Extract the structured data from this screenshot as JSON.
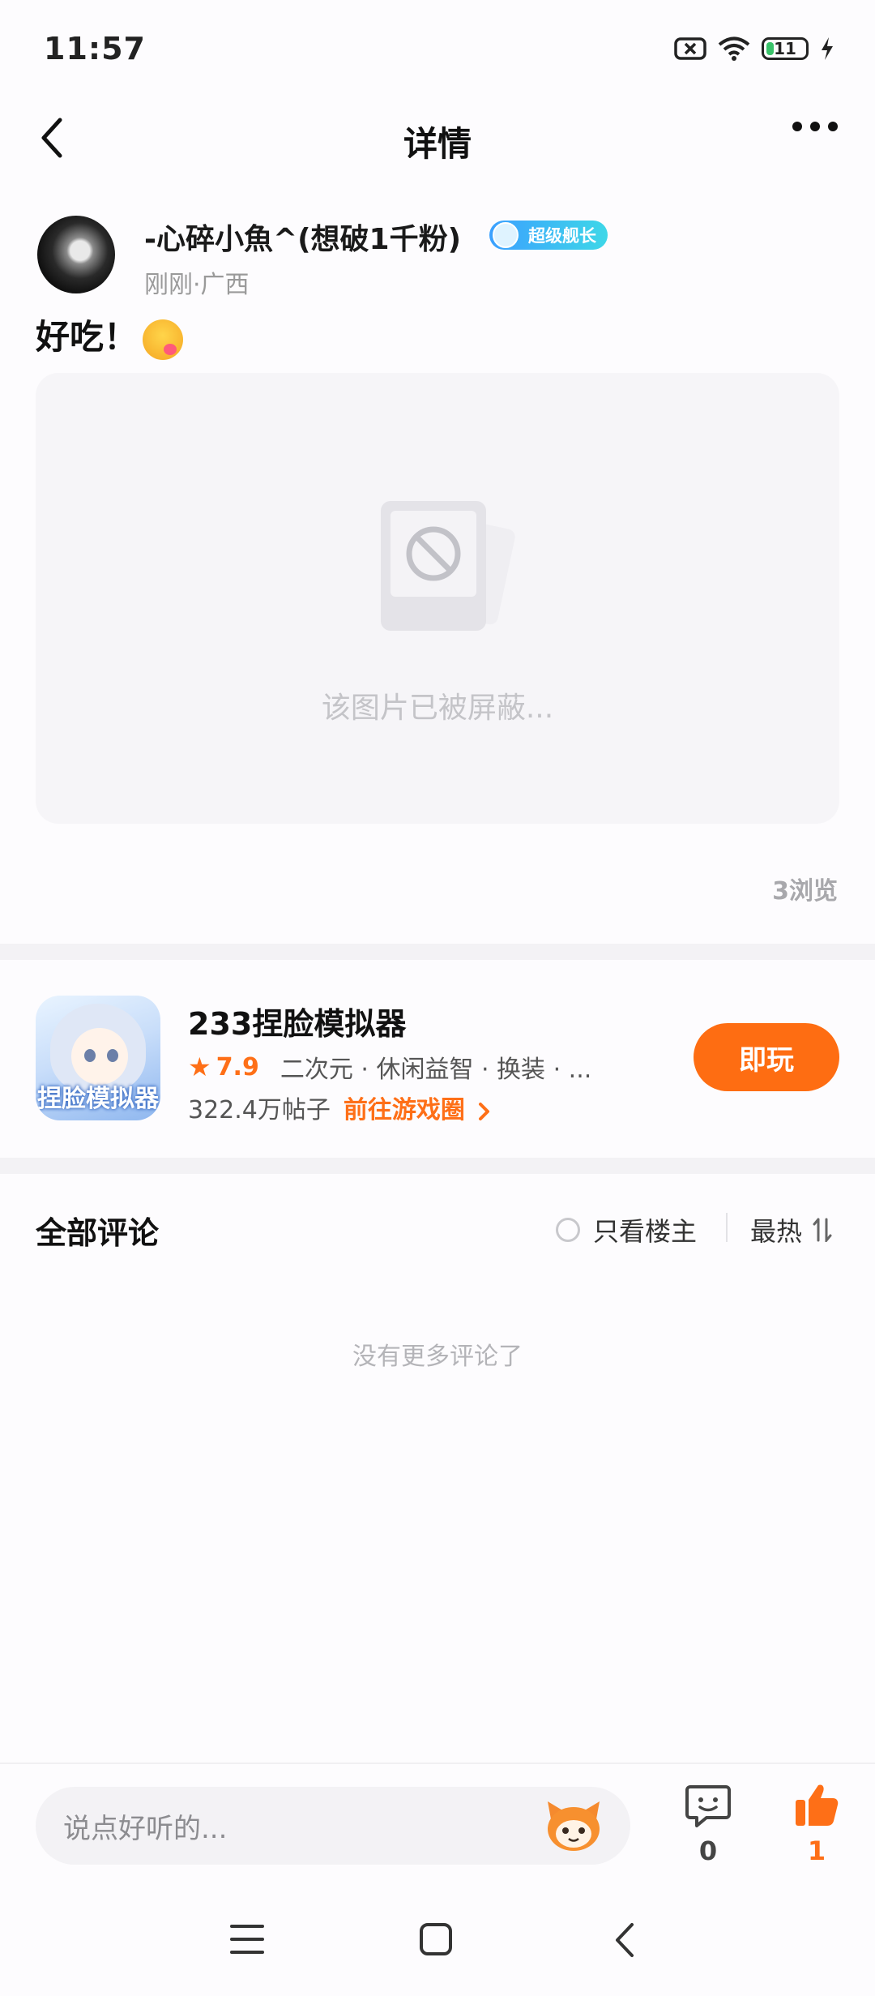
{
  "status_bar": {
    "time": "11:57",
    "battery": "11"
  },
  "header": {
    "title": "详情"
  },
  "post": {
    "username": "-心碎小魚^(想破1千粉)",
    "badge": "超级舰长",
    "meta": "刚刚·广西",
    "text": "好吃！",
    "blocked_text": "该图片已被屏蔽...",
    "views": "3浏览"
  },
  "game": {
    "name": "233捏脸模拟器",
    "icon_text": "捏脸模拟器",
    "rating": "7.9",
    "tags": "二次元 · 休闲益智 · 换装 · ...",
    "posts": "322.4万帖子",
    "go_circle": "前往游戏圈",
    "play_label": "即玩"
  },
  "comments": {
    "title": "全部评论",
    "only_owner": "只看楼主",
    "sort": "最热",
    "empty": "没有更多评论了"
  },
  "bottom_bar": {
    "input_placeholder": "说点好听的...",
    "comment_count": "0",
    "like_count": "1"
  },
  "colors": {
    "accent": "#fe6d12",
    "badge": "#3ba0ff",
    "text": "#111111"
  },
  "icons": [
    "back-icon",
    "more-icon",
    "blocked-image-icon",
    "star-icon",
    "chevron-right-icon",
    "radio-icon",
    "sort-icon",
    "mascot-icon",
    "comment-icon",
    "like-icon",
    "nav-menu-icon",
    "nav-home-icon",
    "nav-back-icon",
    "wifi-icon",
    "sim-icon",
    "battery-icon",
    "charging-icon"
  ]
}
